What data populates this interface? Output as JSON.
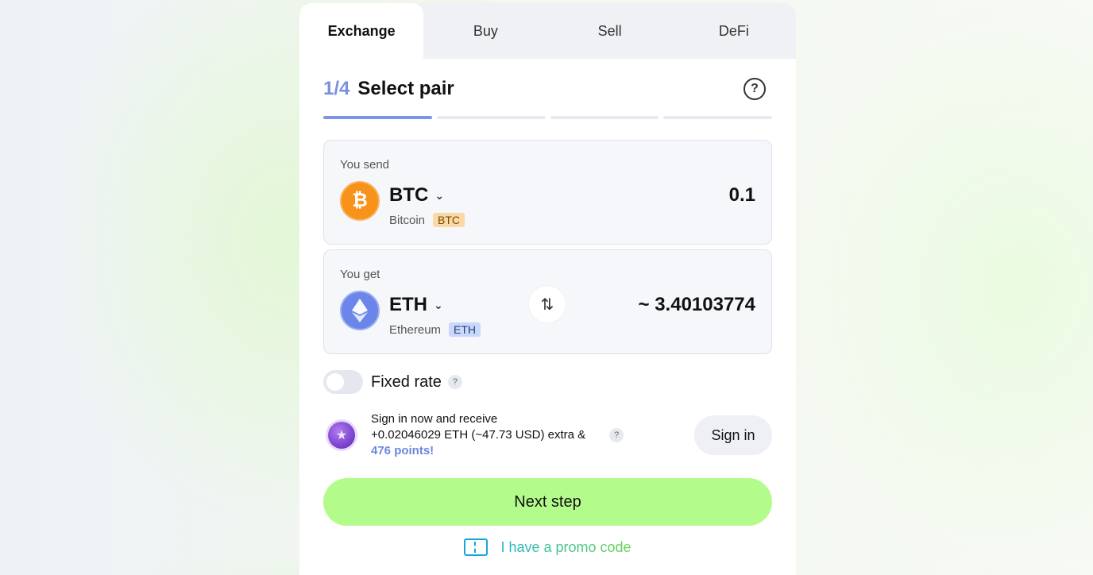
{
  "tabs": [
    {
      "label": "Exchange",
      "active": true
    },
    {
      "label": "Buy",
      "active": false
    },
    {
      "label": "Sell",
      "active": false
    },
    {
      "label": "DeFi",
      "active": false
    }
  ],
  "step": {
    "number": "1/4",
    "title": "Select pair",
    "current": 1,
    "total": 4
  },
  "send": {
    "label": "You send",
    "ticker": "BTC",
    "name": "Bitcoin",
    "badge": "BTC",
    "amount": "0.1",
    "icon": "bitcoin-icon",
    "color": "#f7931a"
  },
  "get": {
    "label": "You get",
    "ticker": "ETH",
    "name": "Ethereum",
    "badge": "ETH",
    "amount": "~ 3.40103774",
    "icon": "ethereum-icon",
    "color": "#6b86e8"
  },
  "fixed_rate": {
    "label": "Fixed rate",
    "enabled": false
  },
  "promo": {
    "line1": "Sign in now and receive",
    "line2": "+0.02046029 ETH (~47.73 USD) extra &",
    "points": "476 points!",
    "signin_label": "Sign in"
  },
  "next_label": "Next step",
  "promo_code_label": "I have a promo code",
  "colors": {
    "accent": "#7b95e6",
    "next_button": "#b3fc8c"
  }
}
